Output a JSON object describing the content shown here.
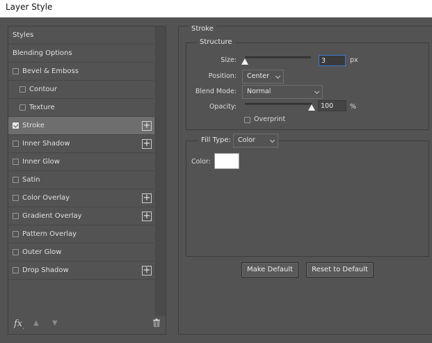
{
  "window": {
    "title": "Layer Style"
  },
  "sidebar": {
    "items": [
      {
        "label": "Styles",
        "checkbox": false,
        "checked": false,
        "sub": false,
        "plus": false,
        "selected": false
      },
      {
        "label": "Blending Options",
        "checkbox": false,
        "checked": false,
        "sub": false,
        "plus": false,
        "selected": false
      },
      {
        "label": "Bevel & Emboss",
        "checkbox": true,
        "checked": false,
        "sub": false,
        "plus": false,
        "selected": false
      },
      {
        "label": "Contour",
        "checkbox": true,
        "checked": false,
        "sub": true,
        "plus": false,
        "selected": false
      },
      {
        "label": "Texture",
        "checkbox": true,
        "checked": false,
        "sub": true,
        "plus": false,
        "selected": false
      },
      {
        "label": "Stroke",
        "checkbox": true,
        "checked": true,
        "sub": false,
        "plus": true,
        "selected": true
      },
      {
        "label": "Inner Shadow",
        "checkbox": true,
        "checked": false,
        "sub": false,
        "plus": true,
        "selected": false
      },
      {
        "label": "Inner Glow",
        "checkbox": true,
        "checked": false,
        "sub": false,
        "plus": false,
        "selected": false
      },
      {
        "label": "Satin",
        "checkbox": true,
        "checked": false,
        "sub": false,
        "plus": false,
        "selected": false
      },
      {
        "label": "Color Overlay",
        "checkbox": true,
        "checked": false,
        "sub": false,
        "plus": true,
        "selected": false
      },
      {
        "label": "Gradient Overlay",
        "checkbox": true,
        "checked": false,
        "sub": false,
        "plus": true,
        "selected": false
      },
      {
        "label": "Pattern Overlay",
        "checkbox": true,
        "checked": false,
        "sub": false,
        "plus": false,
        "selected": false
      },
      {
        "label": "Outer Glow",
        "checkbox": true,
        "checked": false,
        "sub": false,
        "plus": false,
        "selected": false
      },
      {
        "label": "Drop Shadow",
        "checkbox": true,
        "checked": false,
        "sub": false,
        "plus": true,
        "selected": false
      }
    ],
    "footer": {
      "fx_label": "fx",
      "fx_dot": "."
    }
  },
  "stroke": {
    "section_title": "Stroke",
    "structure_title": "Structure",
    "size": {
      "label": "Size:",
      "value": "3",
      "unit": "px",
      "slider_fraction": 0.0
    },
    "position": {
      "label": "Position:",
      "value": "Center"
    },
    "blend_mode": {
      "label": "Blend Mode:",
      "value": "Normal"
    },
    "opacity": {
      "label": "Opacity:",
      "value": "100",
      "unit": "%",
      "slider_fraction": 1.0
    },
    "overprint": {
      "label": "Overprint",
      "checked": false
    },
    "fill_type": {
      "label": "Fill Type:",
      "value": "Color"
    },
    "color": {
      "label": "Color:",
      "swatch": "#ffffff"
    }
  },
  "buttons": {
    "make_default": "Make Default",
    "reset_default": "Reset to Default"
  }
}
